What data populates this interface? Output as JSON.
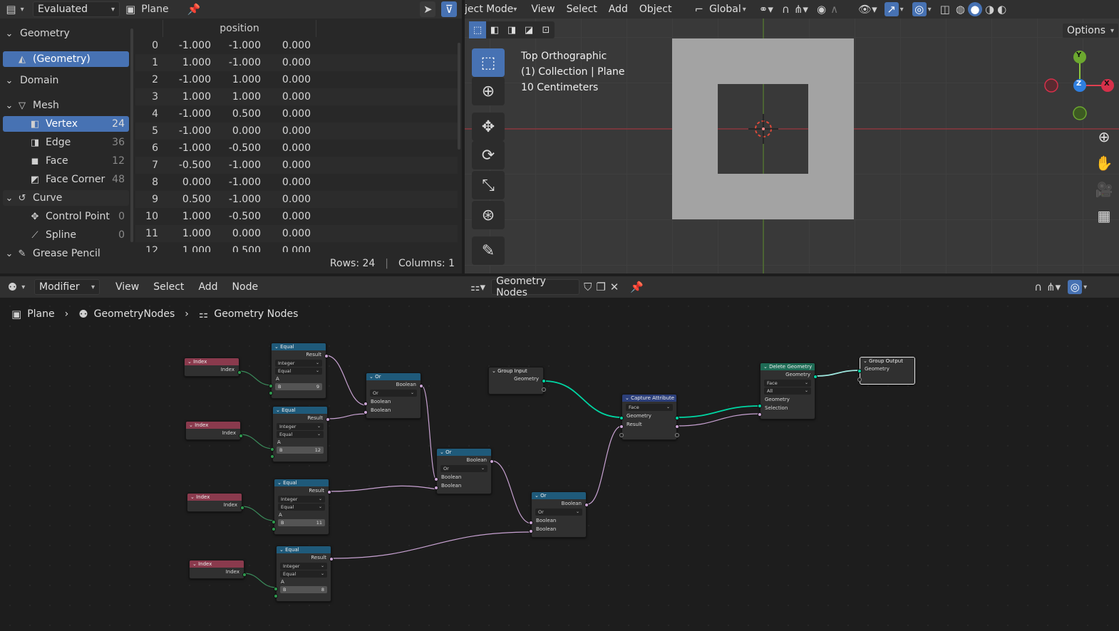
{
  "spreadsheet": {
    "header": {
      "mode": "Evaluated",
      "object": "Plane"
    },
    "tree": {
      "geometry_label": "Geometry",
      "geometry_item": "(Geometry)",
      "domain_label": "Domain",
      "mesh_label": "Mesh",
      "mesh_items": [
        {
          "label": "Vertex",
          "count": "24"
        },
        {
          "label": "Edge",
          "count": "36"
        },
        {
          "label": "Face",
          "count": "12"
        },
        {
          "label": "Face Corner",
          "count": "48"
        }
      ],
      "curve_label": "Curve",
      "curve_items": [
        {
          "label": "Control Point",
          "count": "0"
        },
        {
          "label": "Spline",
          "count": "0"
        }
      ],
      "next_label": "Grease Pencil"
    },
    "column_header": "position",
    "rows": [
      [
        "0",
        "-1.000",
        "-1.000",
        "0.000"
      ],
      [
        "1",
        "1.000",
        "-1.000",
        "0.000"
      ],
      [
        "2",
        "-1.000",
        "1.000",
        "0.000"
      ],
      [
        "3",
        "1.000",
        "1.000",
        "0.000"
      ],
      [
        "4",
        "-1.000",
        "0.500",
        "0.000"
      ],
      [
        "5",
        "-1.000",
        "0.000",
        "0.000"
      ],
      [
        "6",
        "-1.000",
        "-0.500",
        "0.000"
      ],
      [
        "7",
        "-0.500",
        "-1.000",
        "0.000"
      ],
      [
        "8",
        "0.000",
        "-1.000",
        "0.000"
      ],
      [
        "9",
        "0.500",
        "-1.000",
        "0.000"
      ],
      [
        "10",
        "1.000",
        "-0.500",
        "0.000"
      ],
      [
        "11",
        "1.000",
        "0.000",
        "0.000"
      ],
      [
        "12",
        "1.000",
        "0.500",
        "0.000"
      ]
    ],
    "footer": {
      "rows": "Rows: 24",
      "columns": "Columns: 1"
    }
  },
  "viewport": {
    "menus": [
      "ject Mode",
      "View",
      "Select",
      "Add",
      "Object"
    ],
    "orientation": "Global",
    "options_label": "Options",
    "info": [
      "Top Orthographic",
      "(1) Collection | Plane",
      "10 Centimeters"
    ],
    "gizmo": {
      "y": "Y",
      "z": "Z",
      "x": "X"
    }
  },
  "node_editor": {
    "header": {
      "mode": "Modifier",
      "menus": [
        "View",
        "Select",
        "Add",
        "Node"
      ],
      "tree_name": "Geometry Nodes"
    },
    "breadcrumb": [
      "Plane",
      "GeometryNodes",
      "Geometry Nodes"
    ],
    "nodes": {
      "index_title": "Index",
      "index_out": "Index",
      "equal_title": "Equal",
      "equal_out": "Result",
      "equal_type": "Integer",
      "equal_op": "Equal",
      "equal_a": "A",
      "equal_b": "B",
      "equal_b_values": [
        "9",
        "12",
        "11",
        "8"
      ],
      "or_title": "Or",
      "or_out": "Boolean",
      "or_op": "Or",
      "or_in": "Boolean",
      "group_input_title": "Group Input",
      "group_input_geo": "Geometry",
      "capture_title": "Capture Attribute",
      "capture_domain": "Face",
      "capture_geo": "Geometry",
      "capture_result": "Result",
      "delete_title": "Delete Geometry",
      "delete_geo": "Geometry",
      "delete_domain": "Face",
      "delete_mode": "All",
      "delete_sel": "Selection",
      "group_output_title": "Group Output",
      "group_output_geo": "Geometry"
    }
  },
  "colors": {
    "accent": "#4772b3",
    "index_header": "#8a3a4d",
    "math_header": "#1f5a7a",
    "geometry_link": "#00d6a3",
    "bool_link": "#cca6d6"
  }
}
